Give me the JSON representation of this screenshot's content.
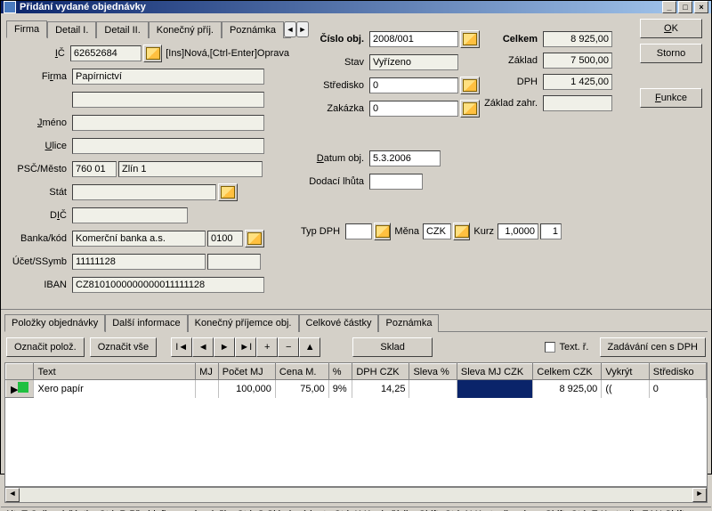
{
  "window": {
    "title": "Přidání vydané objednávky"
  },
  "tabs_top": [
    "Firma",
    "Detail I.",
    "Detail II.",
    "Konečný příj.",
    "Poznámka"
  ],
  "firma": {
    "ic_label": "IČ",
    "ic": "62652684",
    "ic_hint": "[Ins]Nová,[Ctrl-Enter]Oprava",
    "firma_label": "Firma",
    "firma": "Papírnictví",
    "jmeno_label": "Jméno",
    "jmeno": "",
    "ulice_label": "Ulice",
    "ulice": "",
    "pscmesto_label": "PSČ/Město",
    "psc": "760 01",
    "mesto": "Zlín 1",
    "stat_label": "Stát",
    "stat": "",
    "dic_label": "DIČ",
    "dic": "",
    "banka_label": "Banka/kód",
    "banka": "Komerční banka a.s.",
    "banka_kod": "0100",
    "ucet_label": "Účet/SSymb",
    "ucet": "11111128",
    "ssymb": "",
    "iban_label": "IBAN",
    "iban": "CZ8101000000000011111128"
  },
  "order": {
    "cislo_label": "Číslo obj.",
    "cislo": "2008/001",
    "stav_label": "Stav",
    "stav": "Vyřízeno",
    "stredisko_label": "Středisko",
    "stredisko": "0",
    "zakazka_label": "Zakázka",
    "zakazka": "0",
    "datum_label": "Datum obj.",
    "datum": "5.3.2006",
    "lhuta_label": "Dodací lhůta",
    "lhuta": "",
    "typdph_label": "Typ DPH",
    "typdph": "",
    "mena_label": "Měna",
    "mena": "CZK",
    "kurz_label": "Kurz",
    "kurz": "1,0000",
    "kurz2": "1"
  },
  "totals": {
    "celkem_label": "Celkem",
    "celkem": "8 925,00",
    "zaklad_label": "Základ",
    "zaklad": "7 500,00",
    "dph_label": "DPH",
    "dph": "1 425,00",
    "zaklad_zahr_label": "Základ zahr.",
    "zaklad_zahr": ""
  },
  "buttons": {
    "ok": "OK",
    "storno": "Storno",
    "funkce": "Funkce"
  },
  "lower_tabs": [
    "Položky objednávky",
    "Další informace",
    "Konečný příjemce obj.",
    "Celkové částky",
    "Poznámka"
  ],
  "toolbar": {
    "oznacit_poloz": "Označit polož.",
    "oznacit_vse": "Označit vše",
    "sklad": "Sklad",
    "textr": "Text. ř.",
    "zadavani": "Zadávání cen s DPH"
  },
  "grid": {
    "cols": [
      "",
      "Text",
      "MJ",
      "Počet MJ",
      "Cena M.",
      "%",
      "DPH CZK",
      "Sleva %",
      "Sleva MJ CZK",
      "Celkem CZK",
      "Vykrýt",
      "Středisko"
    ],
    "row": {
      "text": "Xero papír",
      "mj": "",
      "pocet": "100,000",
      "cena": "75,00",
      "pct": "9%",
      "dph": "14,25",
      "sleva": "",
      "slevamj": "",
      "celkem": "8 925,00",
      "vykryt": "((",
      "stredisko": "0"
    }
  },
  "statusbar": "Alt+T Celkové částky  Ctrl+R Předdefinované položky  Ctrl+S Skladové karty  Ctrl+K Kopie řádku  Shift+Ctrl+N Karty dle názvu  Shift+Ctrl+E Karty dle EAN  Shift"
}
